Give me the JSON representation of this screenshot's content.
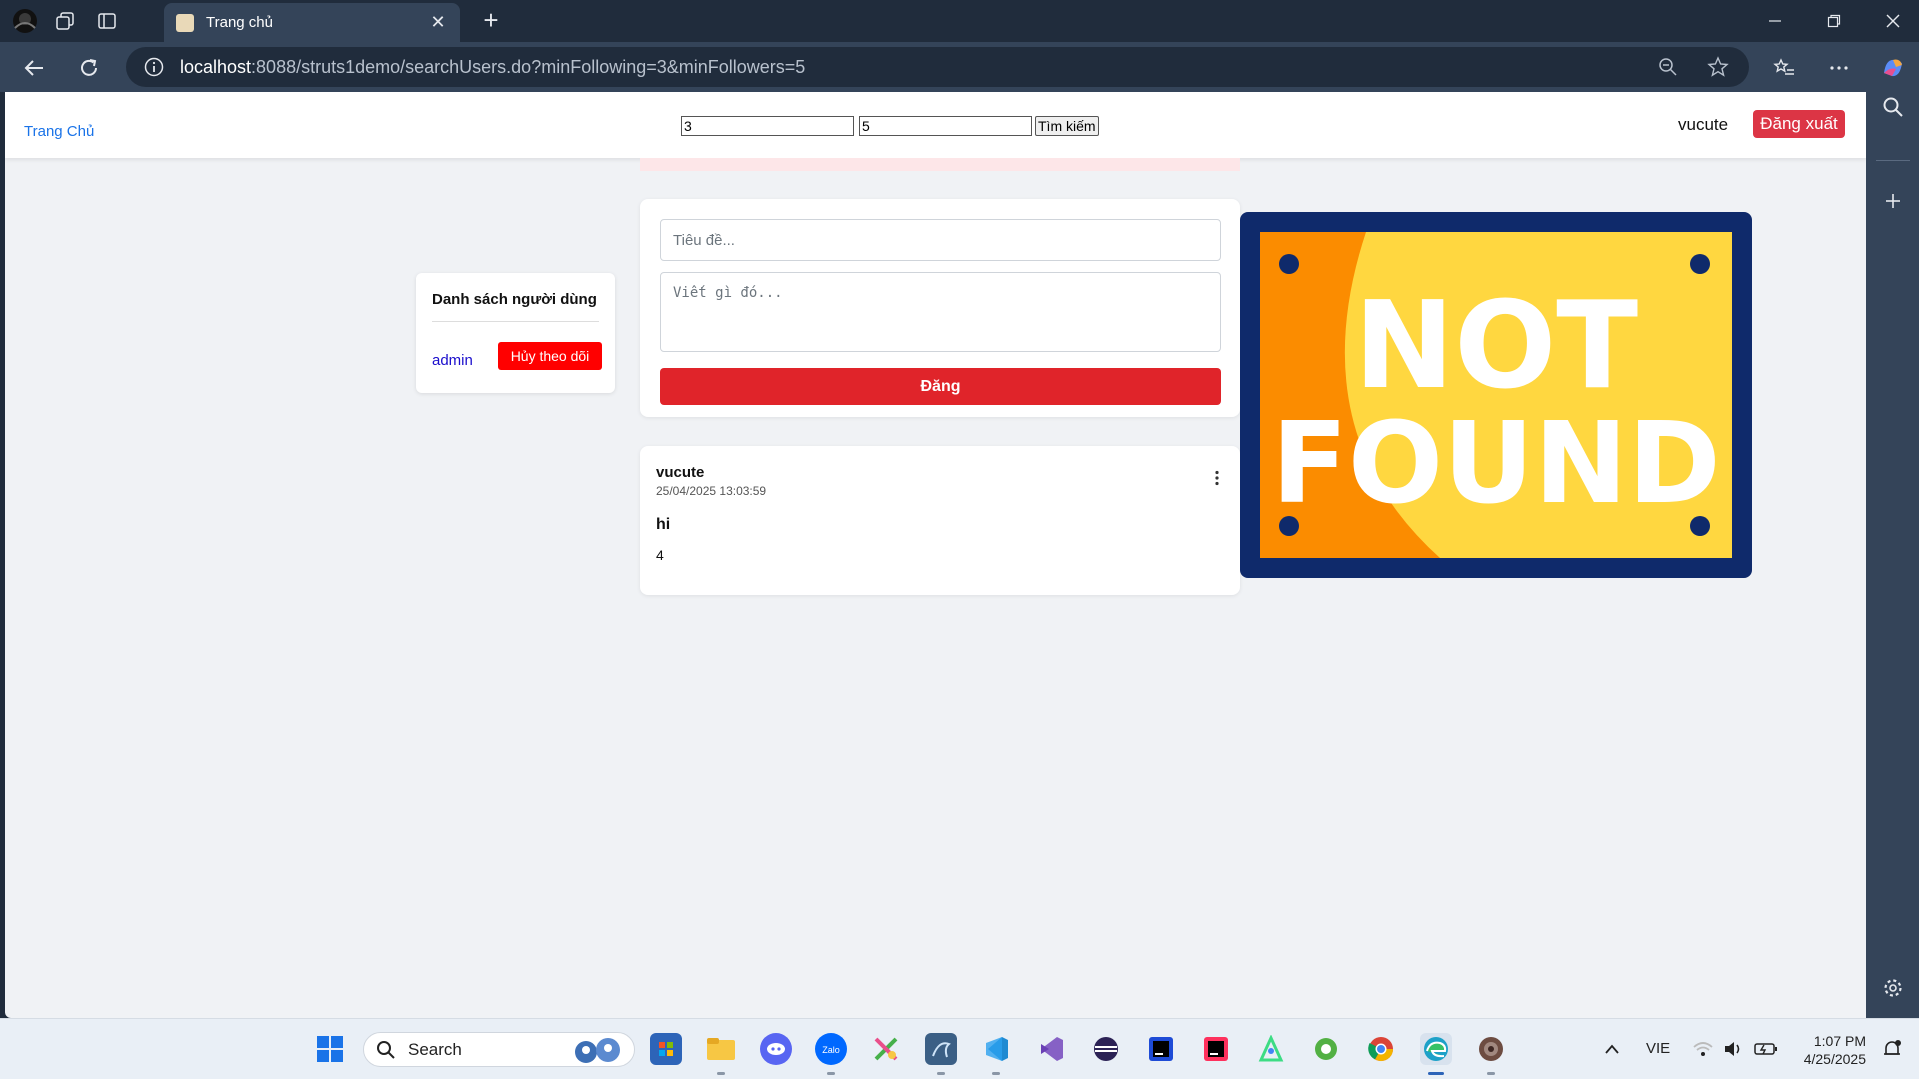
{
  "browser": {
    "tab_title": "Trang chủ",
    "url_host": "localhost",
    "url_rest": ":8088/struts1demo/searchUsers.do?minFollowing=3&minFollowers=5"
  },
  "topnav": {
    "home_label": "Trang Chủ",
    "min_following_value": "3",
    "min_followers_value": "5",
    "search_button_label": "Tìm kiếm",
    "username": "vucute",
    "logout_label": "Đăng xuất"
  },
  "user_list": {
    "heading": "Danh sách người dùng",
    "users": [
      {
        "name": "admin",
        "action_label": "Hủy theo dõi"
      }
    ]
  },
  "composer": {
    "title_placeholder": "Tiêu đề...",
    "body_placeholder": "Viết gì đó...",
    "submit_label": "Đăng"
  },
  "posts": [
    {
      "author": "vucute",
      "timestamp": "25/04/2025 13:03:59",
      "title": "hi",
      "body": "4"
    }
  ],
  "image": {
    "text_line1": "NOT",
    "text_line2": "FOUND"
  },
  "taskbar": {
    "search_label": "Search",
    "language": "VIE",
    "time": "1:07 PM",
    "date": "4/25/2025"
  },
  "colors": {
    "browser_frame": "#202c3c",
    "toolbar": "#344459",
    "page_bg": "#f0f2f5",
    "link_blue": "#1a73e8",
    "danger_red": "#dc3545",
    "post_red": "#e0242a",
    "unfollow_red": "#ff0000",
    "notfound_navy": "#0f2a6b",
    "notfound_orange": "#fb8c00",
    "notfound_yellow": "#ffd740"
  }
}
